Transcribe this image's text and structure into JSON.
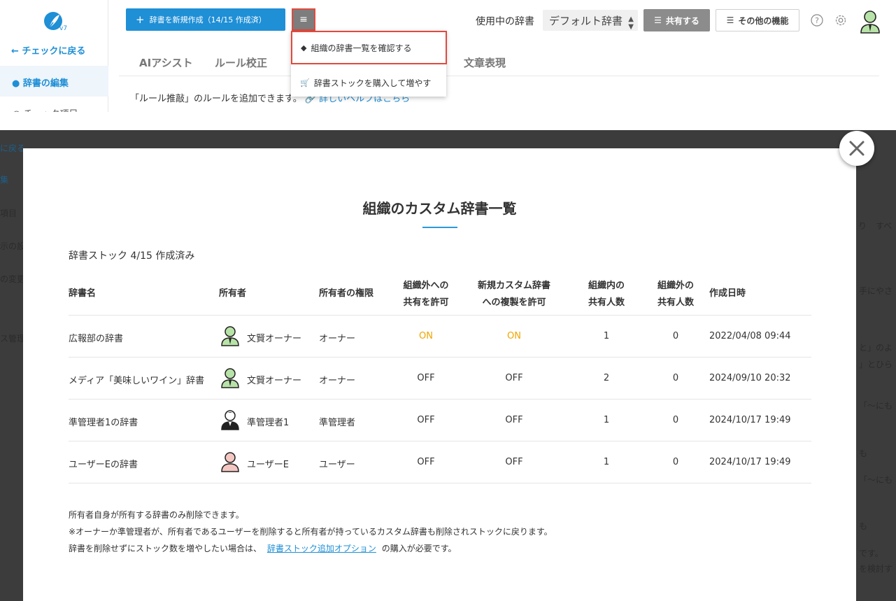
{
  "sidebar": {
    "logo_version": "v7",
    "back_label": "← チェックに戻る",
    "edit_label": "● 辞書の編集",
    "partial_item": "○ チェック項目"
  },
  "toolbar": {
    "new_dict_label": "辞書を新規作成（14/15 作成済）",
    "menu_label": "≡",
    "dict_in_use_label": "使用中の辞書",
    "dict_select_value": "デフォルト辞書",
    "share_label": "共有する",
    "other_label": "その他の機能"
  },
  "dropdown": {
    "items": [
      {
        "label": "組織の辞書一覧を確認する"
      },
      {
        "label": "辞書ストックを購入して増やす"
      }
    ]
  },
  "tabs": [
    {
      "label": "AIアシスト"
    },
    {
      "label": "ルール校正"
    },
    {
      "label": "文章表現"
    }
  ],
  "rule_hint": {
    "text": "「ルール推敲」のルールを追加できます。",
    "link": "詳しいヘルプはこちら"
  },
  "background_fragments": {
    "left": [
      "に戻る",
      "集",
      "項目",
      "示の設",
      "の変更",
      "ス管理"
    ],
    "right": [
      "り",
      "すべ",
      "手にやさ",
      "と」のよ",
      "」とひら",
      "「〜にも",
      "も",
      "「〜にも",
      "も",
      "です。",
      "を検討す"
    ]
  },
  "modal": {
    "title": "組織のカスタム辞書一覧",
    "stock_text": "辞書ストック 4/15 作成済み",
    "columns": {
      "name": "辞書名",
      "owner": "所有者",
      "role": "所有者の権限",
      "external_share_1": "組織外への",
      "external_share_2": "共有を許可",
      "copy_1": "新規カスタム辞書",
      "copy_2": "への複製を許可",
      "internal_count_1": "組織内の",
      "internal_count_2": "共有人数",
      "external_count_1": "組織外の",
      "external_count_2": "共有人数",
      "created": "作成日時"
    },
    "rows": [
      {
        "name": "広報部の辞書",
        "owner": "文賢オーナー",
        "role": "オーナー",
        "external_share": "ON",
        "copy": "ON",
        "internal_count": "1",
        "external_count": "0",
        "created": "2022/04/08 09:44",
        "avatar": "green"
      },
      {
        "name": "メディア「美味しいワイン」辞書",
        "owner": "文賢オーナー",
        "role": "オーナー",
        "external_share": "OFF",
        "copy": "OFF",
        "internal_count": "2",
        "external_count": "0",
        "created": "2024/09/10 20:32",
        "avatar": "green"
      },
      {
        "name": "準管理者1の辞書",
        "owner": "準管理者1",
        "role": "準管理者",
        "external_share": "OFF",
        "copy": "OFF",
        "internal_count": "1",
        "external_count": "0",
        "created": "2024/10/17 19:49",
        "avatar": "black"
      },
      {
        "name": "ユーザーEの辞書",
        "owner": "ユーザーE",
        "role": "ユーザー",
        "external_share": "OFF",
        "copy": "OFF",
        "internal_count": "1",
        "external_count": "0",
        "created": "2024/10/17 19:49",
        "avatar": "pink"
      }
    ],
    "notes": {
      "line1": "所有者自身が所有する辞書のみ削除できます。",
      "line2": "※オーナーか準管理者が、所有者であるユーザーを削除すると所有者が持っているカスタム辞書も削除されストックに戻ります。",
      "line3_pre": "辞書を削除せずにストック数を増やしたい場合は、",
      "line3_link": "辞書ストック追加オプション",
      "line3_post": "の購入が必要です。"
    }
  },
  "colors": {
    "primary": "#1f8fd6",
    "on": "#f0a500",
    "highlight_border": "#e04a3e",
    "overlay": "#3c3c3c"
  }
}
